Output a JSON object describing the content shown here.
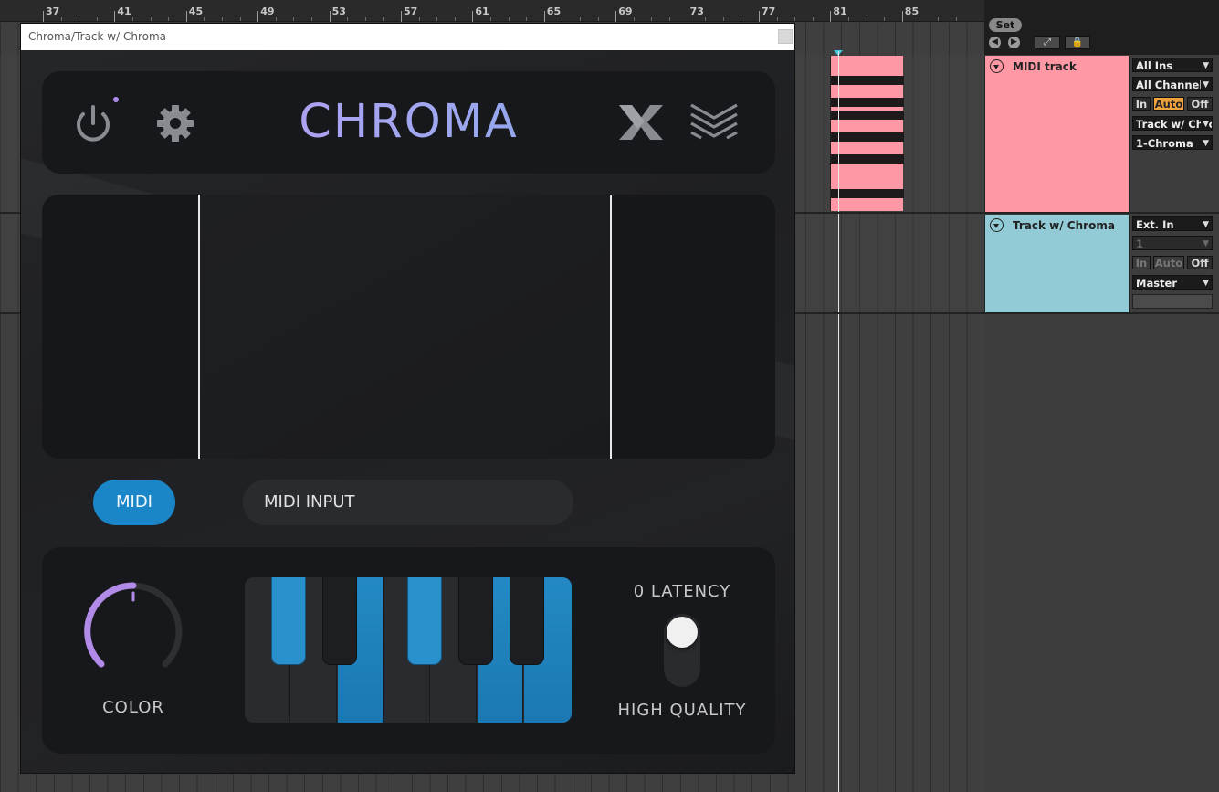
{
  "ruler": {
    "bars": [
      "37",
      "41",
      "45",
      "49",
      "53",
      "57",
      "61",
      "65",
      "69",
      "73",
      "77",
      "81",
      "85"
    ]
  },
  "set": {
    "label": "Set"
  },
  "tracks": [
    {
      "name": "MIDI track",
      "color": "#ff98a5",
      "input_type": "All Ins",
      "input_channel": "All Channels",
      "monitor": [
        "In",
        "Auto",
        "Off"
      ],
      "monitor_active": "Auto",
      "output_type": "Track w/ Chroma",
      "output_channel": "1-Chroma"
    },
    {
      "name": "Track w/ Chroma",
      "color": "#92cbd6",
      "input_type": "Ext. In",
      "input_channel": "1",
      "monitor": [
        "In",
        "Auto",
        "Off"
      ],
      "output_type": "Master",
      "output_channel": ""
    }
  ],
  "plugin": {
    "window_title": "Chroma/Track w/ Chroma",
    "brand": "CHROMA",
    "brand_gradient": [
      "#c39bf2",
      "#6fa6e4"
    ],
    "mode_button": "MIDI",
    "source_field": "MIDI INPUT",
    "color_label": "COLOR",
    "color_knob_value": 0.5,
    "latency_label": "0 LATENCY",
    "quality_label": "HIGH QUALITY",
    "quality_toggle": "0 LATENCY",
    "accent": "#1a86c8",
    "keyboard": {
      "white_keys_on": [
        false,
        false,
        true,
        false,
        false,
        true,
        true
      ],
      "black_keys_on": [
        true,
        false,
        true,
        false,
        false
      ]
    }
  }
}
